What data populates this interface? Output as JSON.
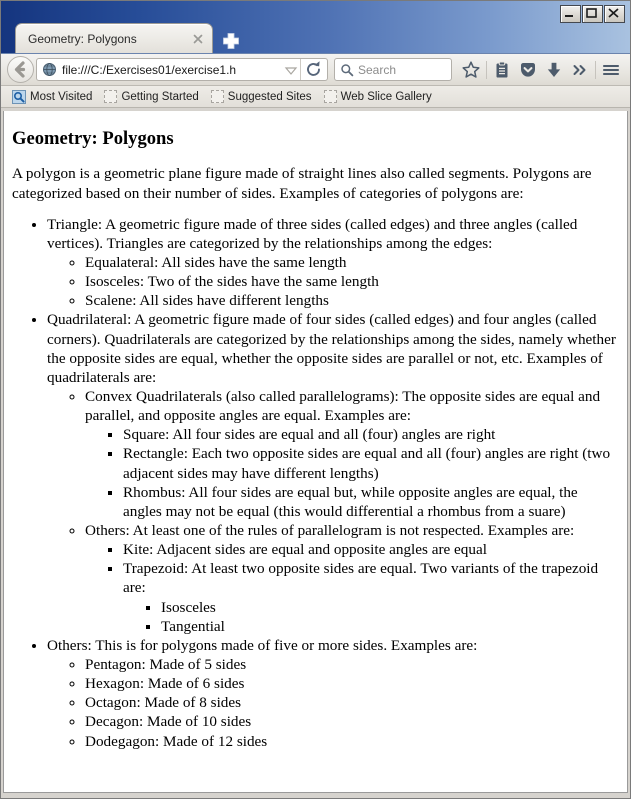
{
  "window": {
    "controls": {
      "minimize": "minimize",
      "maximize": "maximize",
      "close": "close"
    }
  },
  "tabs": {
    "items": [
      {
        "title": "Geometry: Polygons",
        "close_label": "×"
      }
    ],
    "new_tab_label": "+"
  },
  "toolbar": {
    "back_label": "Back",
    "url": "file:///C:/Exercises01/exercise1.h",
    "url_dropdown_label": "▼",
    "reload_label": "Reload",
    "search_placeholder": "Search",
    "icons": [
      {
        "name": "bookmark-star-icon",
        "label": "Bookmark this page"
      },
      {
        "name": "reading-list-icon",
        "label": "Reading list"
      },
      {
        "name": "pocket-icon",
        "label": "Save to Pocket"
      },
      {
        "name": "downloads-icon",
        "label": "Downloads"
      },
      {
        "name": "overflow-chevrons-icon",
        "label": "»"
      },
      {
        "name": "menu-hamburger-icon",
        "label": "Open menu"
      }
    ]
  },
  "bookmarks": {
    "items": [
      {
        "label": "Most Visited",
        "icon": "most-visited-icon"
      },
      {
        "label": "Getting Started",
        "icon": "placeholder-icon"
      },
      {
        "label": "Suggested Sites",
        "icon": "placeholder-icon"
      },
      {
        "label": "Web Slice Gallery",
        "icon": "placeholder-icon"
      }
    ]
  },
  "content": {
    "heading": "Geometry: Polygons",
    "intro": "A polygon is a geometric plane figure made of straight lines also called segments. Polygons are categorized based on their number of sides. Examples of categories of polygons are:",
    "triangle": {
      "text": "Triangle: A geometric figure made of three sides (called edges) and three angles (called vertices). Triangles are categorized by the relationships among the edges:",
      "items": [
        "Equalateral: All sides have the same length",
        "Isosceles: Two of the sides have the same length",
        "Scalene: All sides have different lengths"
      ]
    },
    "quadrilateral": {
      "text": "Quadrilateral: A geometric figure made of four sides (called edges) and four angles (called corners). Quadrilaterals are categorized by the relationships among the sides, namely whether the opposite sides are equal, whether the opposite sides are parallel or not, etc. Examples of quadrilaterals are:",
      "convex": {
        "text": "Convex Quadrilaterals (also called parallelograms): The opposite sides are equal and parallel, and opposite angles are equal. Examples are:",
        "items": [
          "Square: All four sides are equal and all (four) angles are right",
          "Rectangle: Each two opposite sides are equal and all (four) angles are right (two adjacent sides may have different lengths)",
          "Rhombus: All four sides are equal but, while opposite angles are equal, the angles may not be equal (this would differential a rhombus from a suare)"
        ]
      },
      "others": {
        "text": "Others: At least one of the rules of parallelogram is not respected. Examples are:",
        "kite": "Kite: Adjacent sides are equal and opposite angles are equal",
        "trapezoid": {
          "text": "Trapezoid: At least two opposite sides are equal. Two variants of the trapezoid are:",
          "items": [
            "Isosceles",
            "Tangential"
          ]
        }
      }
    },
    "others": {
      "text": "Others: This is for polygons made of five or more sides. Examples are:",
      "items": [
        "Pentagon: Made of 5 sides",
        "Hexagon: Made of 6 sides",
        "Octagon: Made of 8 sides",
        "Decagon: Made of 10 sides",
        "Dodegagon: Made of 12 sides"
      ]
    }
  },
  "colors": {
    "titlebar_dark": "#15357f",
    "titlebar_light": "#a9c2e0",
    "toolbar_icon": "#4d5b6b",
    "bookmark_icon": "#2d6fb5",
    "page_background": "#ffffff",
    "page_text": "#000000"
  }
}
